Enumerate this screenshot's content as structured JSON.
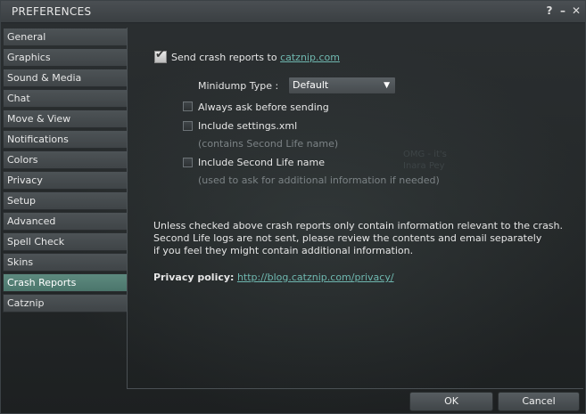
{
  "window": {
    "title": "PREFERENCES",
    "help_glyph": "?",
    "minimize_glyph": "–",
    "close_glyph": "✕"
  },
  "sidebar": {
    "items": [
      {
        "label": "General"
      },
      {
        "label": "Graphics"
      },
      {
        "label": "Sound & Media"
      },
      {
        "label": "Chat"
      },
      {
        "label": "Move & View"
      },
      {
        "label": "Notifications"
      },
      {
        "label": "Colors"
      },
      {
        "label": "Privacy"
      },
      {
        "label": "Setup"
      },
      {
        "label": "Advanced"
      },
      {
        "label": "Spell Check"
      },
      {
        "label": "Skins"
      },
      {
        "label": "Crash Reports",
        "selected": true
      },
      {
        "label": "Catznip"
      }
    ]
  },
  "crash": {
    "send_label": "Send crash reports to",
    "send_link": "catznip.com",
    "send_checked": true,
    "minidump_label": "Minidump Type :",
    "minidump_value": "Default",
    "always_ask_label": "Always ask before sending",
    "include_settings_label": "Include settings.xml",
    "include_settings_hint": "(contains Second Life name)",
    "include_name_label": "Include Second Life name",
    "include_name_hint": "(used to ask for additional information if needed)",
    "info_line1": "Unless checked above crash reports only contain information relevant to the crash.",
    "info_line2": "Second Life logs are not sent, please review the contents and email separately",
    "info_line3": "if you feel they might contain additional information.",
    "privacy_label": "Privacy policy:",
    "privacy_link": "http://blog.catznip.com/privacy/"
  },
  "watermark": {
    "line1": "OMG - it's",
    "line2": "Inara Pey"
  },
  "buttons": {
    "ok": "OK",
    "cancel": "Cancel"
  },
  "colors": {
    "accent_selected": "#5d8a7f",
    "link": "#6fb8b0"
  }
}
